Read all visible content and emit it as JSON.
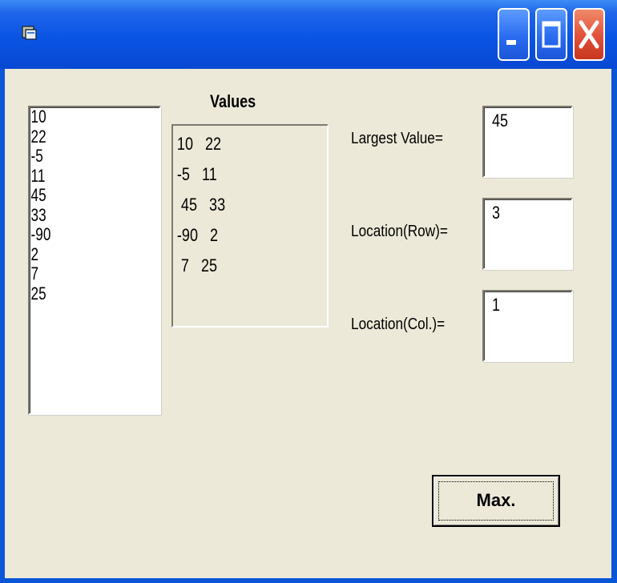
{
  "window": {
    "app_icon": "app-icon",
    "controls": [
      "minimize-icon",
      "maximize-icon",
      "close-icon"
    ]
  },
  "list": {
    "items": [
      "10",
      "22",
      "-5",
      "11",
      "45",
      "33",
      "-90",
      " 2",
      " 7",
      "25"
    ]
  },
  "values": {
    "title": "Values",
    "rows": [
      "10   22",
      "-5   11",
      " 45   33",
      "-90   2",
      " 7   25"
    ]
  },
  "results": {
    "largest_label": "Largest Value=",
    "largest_value": "45",
    "row_label": "Location(Row)=",
    "row_value": "3",
    "col_label": "Location(Col.)=",
    "col_value": "1"
  },
  "buttons": {
    "max_label": "Max."
  }
}
